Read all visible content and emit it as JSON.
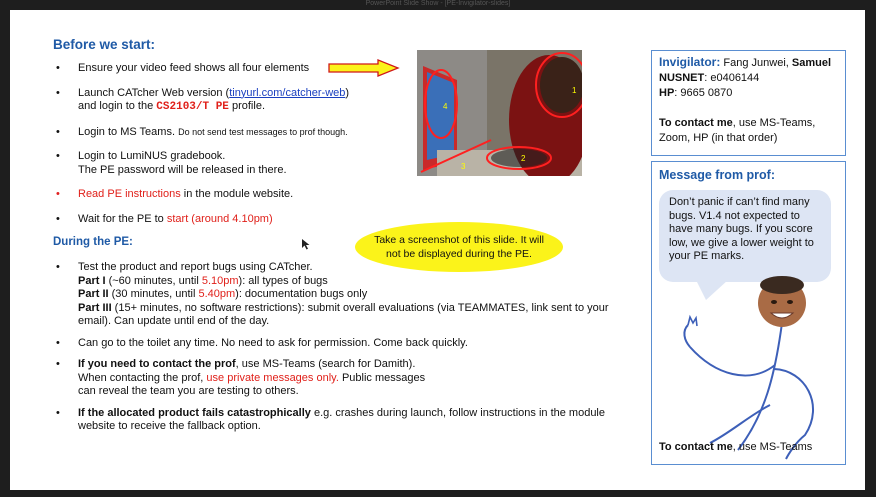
{
  "window_title": "PowerPoint Slide Show - [PE-Invigilator-slides]",
  "before": {
    "heading": "Before we start:",
    "b1": "Ensure your video feed shows all four elements",
    "b2_pre": "Launch CATcher Web version (",
    "b2_link": "tinyurl.com/catcher-web",
    "b2_post": ")",
    "b2_line2_pre": "and login to the ",
    "b2_code": "CS2103/T PE",
    "b2_line2_post": " profile.",
    "b3_main": "Login to MS Teams. ",
    "b3_small": "Do not send test messages to prof though.",
    "b4_l1": "Login to LumiNUS gradebook.",
    "b4_l2": "The PE password will be released in there.",
    "b5_red": "Read PE instructions",
    "b5_rest": " in the module website.",
    "b6_pre": "Wait for the PE to ",
    "b6_red": "start (around 4.10pm)"
  },
  "photo_labels": [
    "4",
    "1",
    "2",
    "3"
  ],
  "callout": "Take a screenshot of this slide. It will not be displayed during the PE.",
  "during": {
    "heading": "During the PE:",
    "d1_l1": "Test the product and report bugs using CATcher.",
    "d1_p1_b": "Part I",
    "d1_p1_a": " (~60 minutes, until ",
    "d1_p1_red": "5.10pm",
    "d1_p1_c": "): all types of bugs",
    "d1_p2_b": "Part II",
    "d1_p2_a": " (30 minutes, until ",
    "d1_p2_red": "5.40pm",
    "d1_p2_c": "): documentation bugs only",
    "d1_p3_b": "Part III",
    "d1_p3_a": " (15+ minutes, no software restrictions): submit overall evaluations (via TEAMMATES, link sent to your email). Can update until end of the day.",
    "d2": "Can go to the toilet any time. No need to ask for permission. Come back quickly.",
    "d3_b": "If you need to contact the prof",
    "d3_a": ", use MS-Teams (search for Damith).",
    "d3_l2_a": "When contacting the prof, ",
    "d3_l2_red": "use private messages only.",
    "d3_l2_c": " Public messages",
    "d3_l3": " can reveal the team you are testing to others.",
    "d4_b": "If the allocated product fails catastrophically",
    "d4_a": " e.g. crashes during launch, follow instructions in the module website to receive the fallback option."
  },
  "invig": {
    "label": "Invigilator:",
    "name_plain": " Fang Junwei, ",
    "name_bold": "Samuel",
    "nusnet_label": "NUSNET",
    "nusnet": ": e0406144",
    "hp_label": "HP",
    "hp": ": 9665 0870",
    "contact_b": "To contact me",
    "contact": ", use MS-Teams, Zoom, HP (in that order)"
  },
  "prof": {
    "heading": "Message from prof:",
    "bubble": "Don’t panic if can’t find many bugs. V1.4 not expected to have many bugs. If you score low, we give a lower weight to your PE marks.",
    "contact_b": "To contact me",
    "contact": ", use MS-Teams"
  },
  "colors": {
    "heading_blue": "#1f5aa6",
    "red": "#e0201a",
    "callout_yellow": "#fbf31a",
    "bubble": "#dde5f4"
  }
}
